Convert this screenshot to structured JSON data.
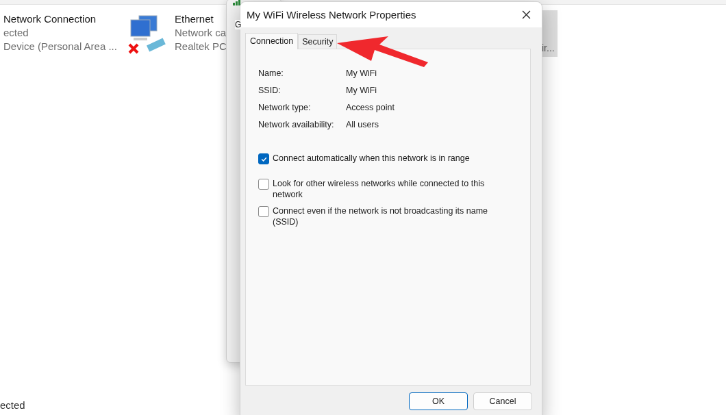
{
  "explorer": {
    "connections": [
      {
        "kind": "cut",
        "name": "Network Connection",
        "status": "ected",
        "device": "Device (Personal Area ..."
      },
      {
        "kind": "full",
        "name": "Ethernet",
        "status": "Network ca",
        "device": "Realtek PC",
        "disconnected": true
      }
    ],
    "selected_tile": {
      "label": "ir..."
    },
    "status_bar": "ected"
  },
  "status_window": {
    "tab": "G"
  },
  "dialog": {
    "title": "My WiFi Wireless Network Properties",
    "tabs": [
      {
        "label": "Connection",
        "selected": true
      },
      {
        "label": "Security",
        "selected": false
      }
    ],
    "fields": [
      {
        "label": "Name:",
        "value": "My WiFi"
      },
      {
        "label": "SSID:",
        "value": "My WiFi"
      },
      {
        "label": "Network type:",
        "value": "Access point"
      },
      {
        "label": "Network availability:",
        "value": "All users"
      }
    ],
    "options": [
      {
        "label": "Connect automatically when this network is in range",
        "checked": true
      },
      {
        "label": "Look for other wireless networks while connected to this network",
        "checked": false
      },
      {
        "label": "Connect even if the network is not broadcasting its name (SSID)",
        "checked": false
      }
    ],
    "buttons": [
      {
        "label": "OK",
        "default": true
      },
      {
        "label": "Cancel",
        "default": false
      }
    ]
  }
}
